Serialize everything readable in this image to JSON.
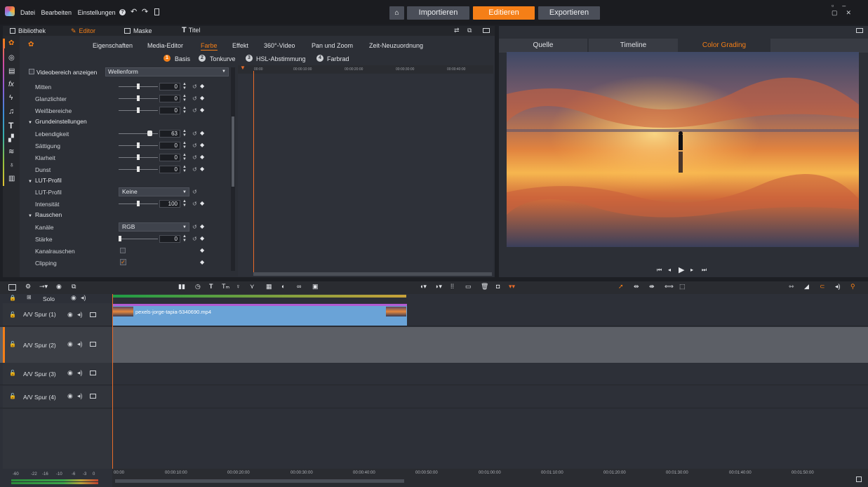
{
  "menu": {
    "file": "Datei",
    "edit": "Bearbeiten",
    "settings": "Einstellungen"
  },
  "modes": {
    "import": "Importieren",
    "edit": "Editieren",
    "export": "Exportieren"
  },
  "left_tabs": {
    "library": "Bibliothek",
    "editor": "Editor",
    "mask": "Maske",
    "title": "Titel"
  },
  "editor_tabs": [
    "Eigenschaften",
    "Media-Editor",
    "Farbe",
    "Effekt",
    "360°-Video",
    "Pan und Zoom",
    "Zeit-Neuzuordnung"
  ],
  "color_tabs": [
    {
      "num": "1",
      "label": "Basis"
    },
    {
      "num": "2",
      "label": "Tonkurve"
    },
    {
      "num": "3",
      "label": "HSL-Abstimmung"
    },
    {
      "num": "4",
      "label": "Farbrad"
    }
  ],
  "scope": {
    "checkbox_label": "Videobereich anzeigen",
    "mode": "Wellenform"
  },
  "params": {
    "mitten": {
      "label": "Mitten",
      "value": "0"
    },
    "glanzlichter": {
      "label": "Glanzlichter",
      "value": "0"
    },
    "weiss": {
      "label": "Weißbereiche",
      "value": "0"
    },
    "grund": "Grundeinstellungen",
    "lebendigkeit": {
      "label": "Lebendigkeit",
      "value": "63"
    },
    "saettigung": {
      "label": "Sättigung",
      "value": "0"
    },
    "klarheit": {
      "label": "Klarheit",
      "value": "0"
    },
    "dunst": {
      "label": "Dunst",
      "value": "0"
    },
    "lut_section": "LUT-Profil",
    "lut": {
      "label": "LUT-Profil",
      "value": "Keine"
    },
    "intensitaet": {
      "label": "Intensität",
      "value": "100"
    },
    "rauschen": "Rauschen",
    "kanale": {
      "label": "Kanäle",
      "value": "RGB"
    },
    "staerke": {
      "label": "Stärke",
      "value": "0"
    },
    "kanalrauschen": {
      "label": "Kanalrauschen"
    },
    "clipping": {
      "label": "Clipping"
    }
  },
  "kf_ruler": [
    "00:00",
    "00:00:10:00",
    "00:00:20:00",
    "00:00:30:00",
    "00:00:40:00"
  ],
  "right_tabs": {
    "source": "Quelle",
    "timeline": "Timeline",
    "grading": "Color Grading"
  },
  "tracks": {
    "solo": "Solo",
    "t1": "A/V Spur (1)",
    "t2": "A/V Spur (2)",
    "t3": "A/V Spur (3)",
    "t4": "A/V Spur (4)",
    "clip": "pexels-jorge-tapia-5340690.mp4"
  },
  "tl_ruler": [
    "00:00",
    "00:00:10:00",
    "00:00:20:00",
    "00:00:30:00",
    "00:00:40:00",
    "00:00:50:00",
    "00:01:00:00",
    "00:01:10:00",
    "00:01:20:00",
    "00:01:30:00",
    "00:01:40:00",
    "00:01:50:00"
  ],
  "meter": [
    "-60",
    "-22",
    "-16",
    "-10",
    "-6",
    "-3",
    "0"
  ],
  "colors": {
    "accent": "#f57f17",
    "bg": "#2c2f36"
  }
}
